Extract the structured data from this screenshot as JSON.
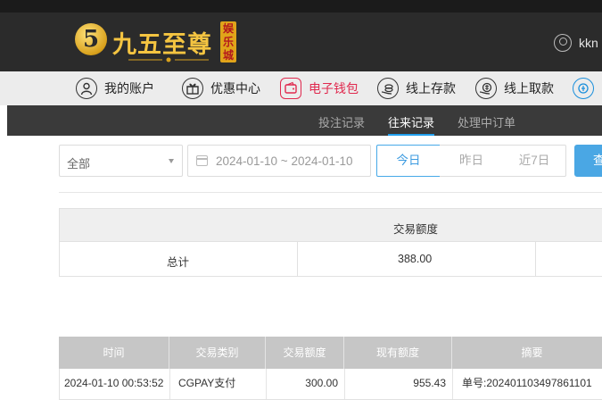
{
  "brand": {
    "coin_glyph": "5",
    "name": "九五至尊",
    "tag": "娱乐城"
  },
  "user": {
    "name": "kkn"
  },
  "nav": {
    "items": [
      {
        "label": "我的账户",
        "icon": "user-icon"
      },
      {
        "label": "优惠中心",
        "icon": "gift-icon"
      },
      {
        "label": "电子钱包",
        "icon": "wallet-icon",
        "active": true
      },
      {
        "label": "线上存款",
        "icon": "deposit-icon"
      },
      {
        "label": "线上取款",
        "icon": "withdraw-icon"
      }
    ]
  },
  "subnav": {
    "tabs": [
      {
        "label": "投注记录"
      },
      {
        "label": "往来记录",
        "active": true
      },
      {
        "label": "处理中订单"
      }
    ]
  },
  "filters": {
    "type_select": "全部",
    "date_range": "2024-01-10 ~ 2024-01-10",
    "today": "今日",
    "yesterday": "昨日",
    "last7": "近7日",
    "search": "查"
  },
  "summary": {
    "header": "交易额度",
    "row_label": "总计",
    "row_value": "388.00"
  },
  "records": {
    "columns": [
      "时间",
      "交易类别",
      "交易额度",
      "现有额度",
      "摘要"
    ],
    "rows": [
      [
        "2024-01-10 00:53:52",
        "CGPAY支付",
        "300.00",
        "955.43",
        "单号:202401103497861101"
      ]
    ]
  },
  "colors": {
    "accent": "#21a0ef",
    "active_nav": "#e0294e",
    "brand_gold": "#f4c441"
  }
}
